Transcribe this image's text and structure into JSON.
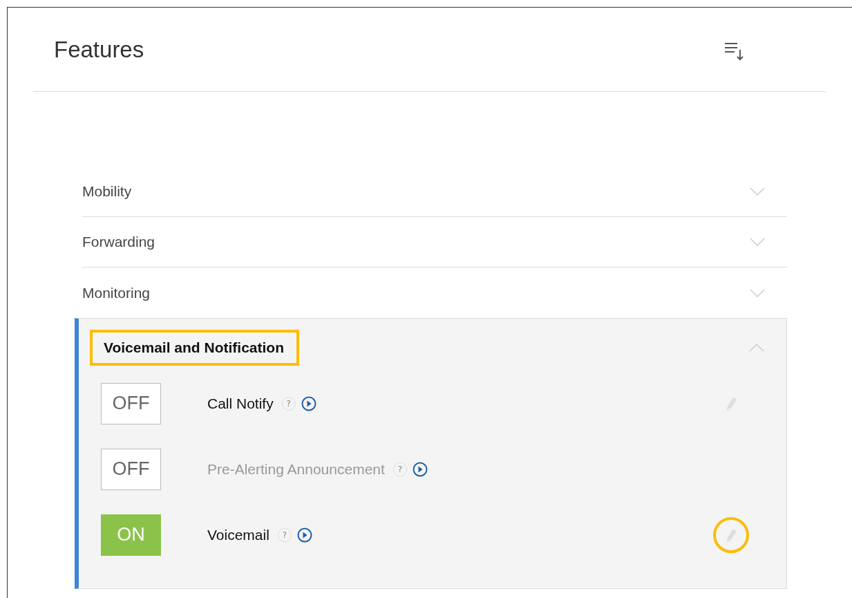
{
  "title": "Features",
  "sections": [
    {
      "label": "Mobility",
      "expanded": false
    },
    {
      "label": "Forwarding",
      "expanded": false
    },
    {
      "label": "Monitoring",
      "expanded": false
    },
    {
      "label": "Voicemail and Notification",
      "expanded": true,
      "highlighted": true,
      "items": [
        {
          "toggle": "OFF",
          "on": false,
          "label": "Call Notify",
          "disabled": false,
          "help": "?",
          "editable": true,
          "edit_highlighted": false
        },
        {
          "toggle": "OFF",
          "on": false,
          "label": "Pre-Alerting Announcement",
          "disabled": true,
          "help": "?",
          "editable": false
        },
        {
          "toggle": "ON",
          "on": true,
          "label": "Voicemail",
          "disabled": false,
          "help": "?",
          "editable": true,
          "edit_highlighted": true
        }
      ]
    }
  ]
}
